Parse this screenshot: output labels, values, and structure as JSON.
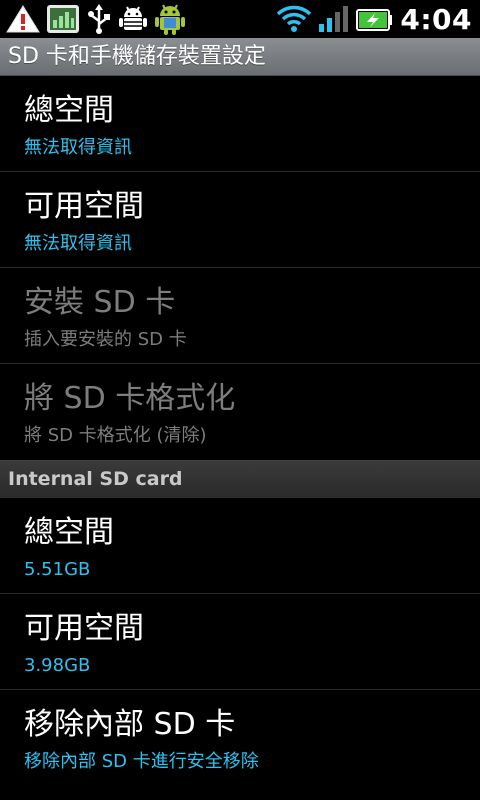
{
  "status_bar": {
    "time": "4:04",
    "icons": [
      "warning-icon",
      "chart-app-icon",
      "usb-icon",
      "android-debug-icon",
      "android-icon",
      "wifi-icon",
      "signal-icon",
      "battery-charging-icon"
    ],
    "colors": {
      "wifi": "#2cc1f0",
      "signal": "#2cc1f0",
      "battery": "#44c43a",
      "warning": "#e02020"
    }
  },
  "title_bar": {
    "title": "SD 卡和手機儲存裝置設定"
  },
  "sd_section": {
    "items": [
      {
        "title": "總空間",
        "summary": "無法取得資訊"
      },
      {
        "title": "可用空間",
        "summary": "無法取得資訊"
      },
      {
        "title": "安裝 SD 卡",
        "summary": "插入要安裝的 SD 卡"
      },
      {
        "title": "將 SD 卡格式化",
        "summary": "將 SD 卡格式化 (清除)"
      }
    ]
  },
  "internal_section": {
    "header": "Internal SD card",
    "items": [
      {
        "title": "總空間",
        "summary": "5.51GB"
      },
      {
        "title": "可用空間",
        "summary": "3.98GB"
      },
      {
        "title": "移除內部 SD 卡",
        "summary": "移除內部 SD 卡進行安全移除"
      }
    ]
  },
  "theme": {
    "accent": "#2cc1f0",
    "disabled_text": "#7d7d7d"
  }
}
